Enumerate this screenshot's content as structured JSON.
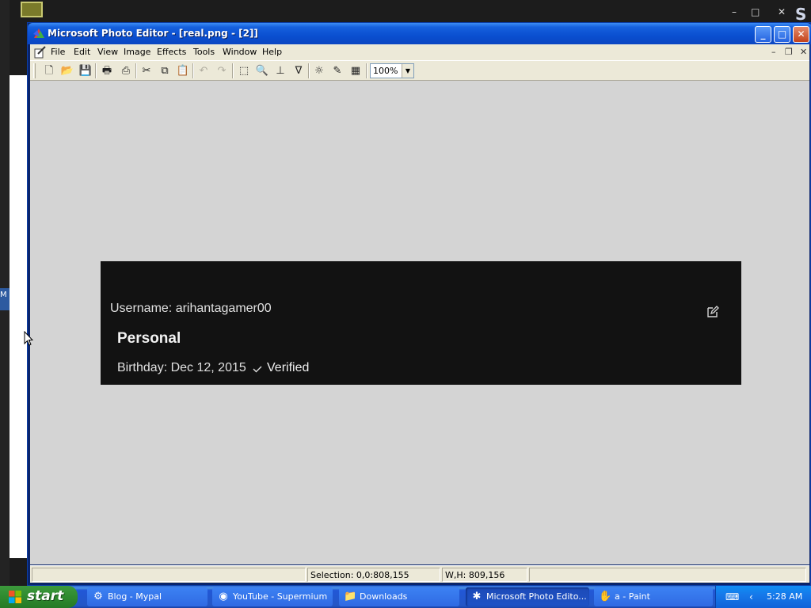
{
  "window": {
    "title": "Microsoft Photo Editor - [real.png - [2]]",
    "controls": {
      "minimize": "_",
      "maximize": "□",
      "close": "✕"
    }
  },
  "background_window": {
    "tab_letter": "M",
    "letter_s": "S",
    "controls": {
      "minimize": "–",
      "restore": "□",
      "close": "✕"
    }
  },
  "menu": {
    "items": [
      "File",
      "Edit",
      "View",
      "Image",
      "Effects",
      "Tools",
      "Window",
      "Help"
    ],
    "mdi_controls": {
      "minimize": "–",
      "restore": "❐",
      "close": "✕"
    }
  },
  "toolbar": {
    "icons": [
      {
        "name": "new-icon",
        "glyph": "🗋"
      },
      {
        "name": "open-icon",
        "glyph": "📂"
      },
      {
        "name": "save-icon",
        "glyph": "💾"
      },
      {
        "name": "print-icon",
        "glyph": "🖶"
      },
      {
        "name": "scan-icon",
        "glyph": "⎙"
      },
      {
        "name": "cut-icon",
        "glyph": "✂"
      },
      {
        "name": "copy-icon",
        "glyph": "⧉"
      },
      {
        "name": "paste-icon",
        "glyph": "📋"
      },
      {
        "name": "undo-icon",
        "glyph": "↶"
      },
      {
        "name": "redo-icon",
        "glyph": "↷"
      },
      {
        "name": "select-icon",
        "glyph": "⬚"
      },
      {
        "name": "zoom-icon",
        "glyph": "🔍"
      },
      {
        "name": "text-icon",
        "glyph": "⊥"
      },
      {
        "name": "eyedropper-icon",
        "glyph": "∇"
      },
      {
        "name": "brightness-icon",
        "glyph": "☼"
      },
      {
        "name": "pencil-icon",
        "glyph": "✎"
      },
      {
        "name": "properties-icon",
        "glyph": "▦"
      }
    ],
    "zoom_value": "100%",
    "zoom_arrow": "▼"
  },
  "card": {
    "username": "Username: arihantagamer00",
    "heading": "Personal",
    "birthday": "Birthday: Dec 12, 2015",
    "verified": "Verified"
  },
  "status": {
    "selection": "Selection: 0,0:808,155",
    "size": "W,H: 809,156"
  },
  "taskbar": {
    "start_label": "start",
    "tasks": [
      {
        "label": "Blog - Mypal",
        "icon": "⚙"
      },
      {
        "label": "YouTube - Supermium",
        "icon": "◉"
      },
      {
        "label": "Downloads",
        "icon": "📁"
      },
      {
        "label": "Microsoft Photo Edito...",
        "icon": "✱"
      },
      {
        "label": "a - Paint",
        "icon": "✋"
      }
    ],
    "tray_icons": [
      "⌨",
      "‹"
    ],
    "clock": "5:28 AM"
  },
  "colors": {
    "workspace": "#d4d4d4",
    "card_bg": "#121212",
    "titlebar": "#0a4fd0",
    "taskbar": "#2457c6",
    "start_button": "#2f8a2f"
  }
}
